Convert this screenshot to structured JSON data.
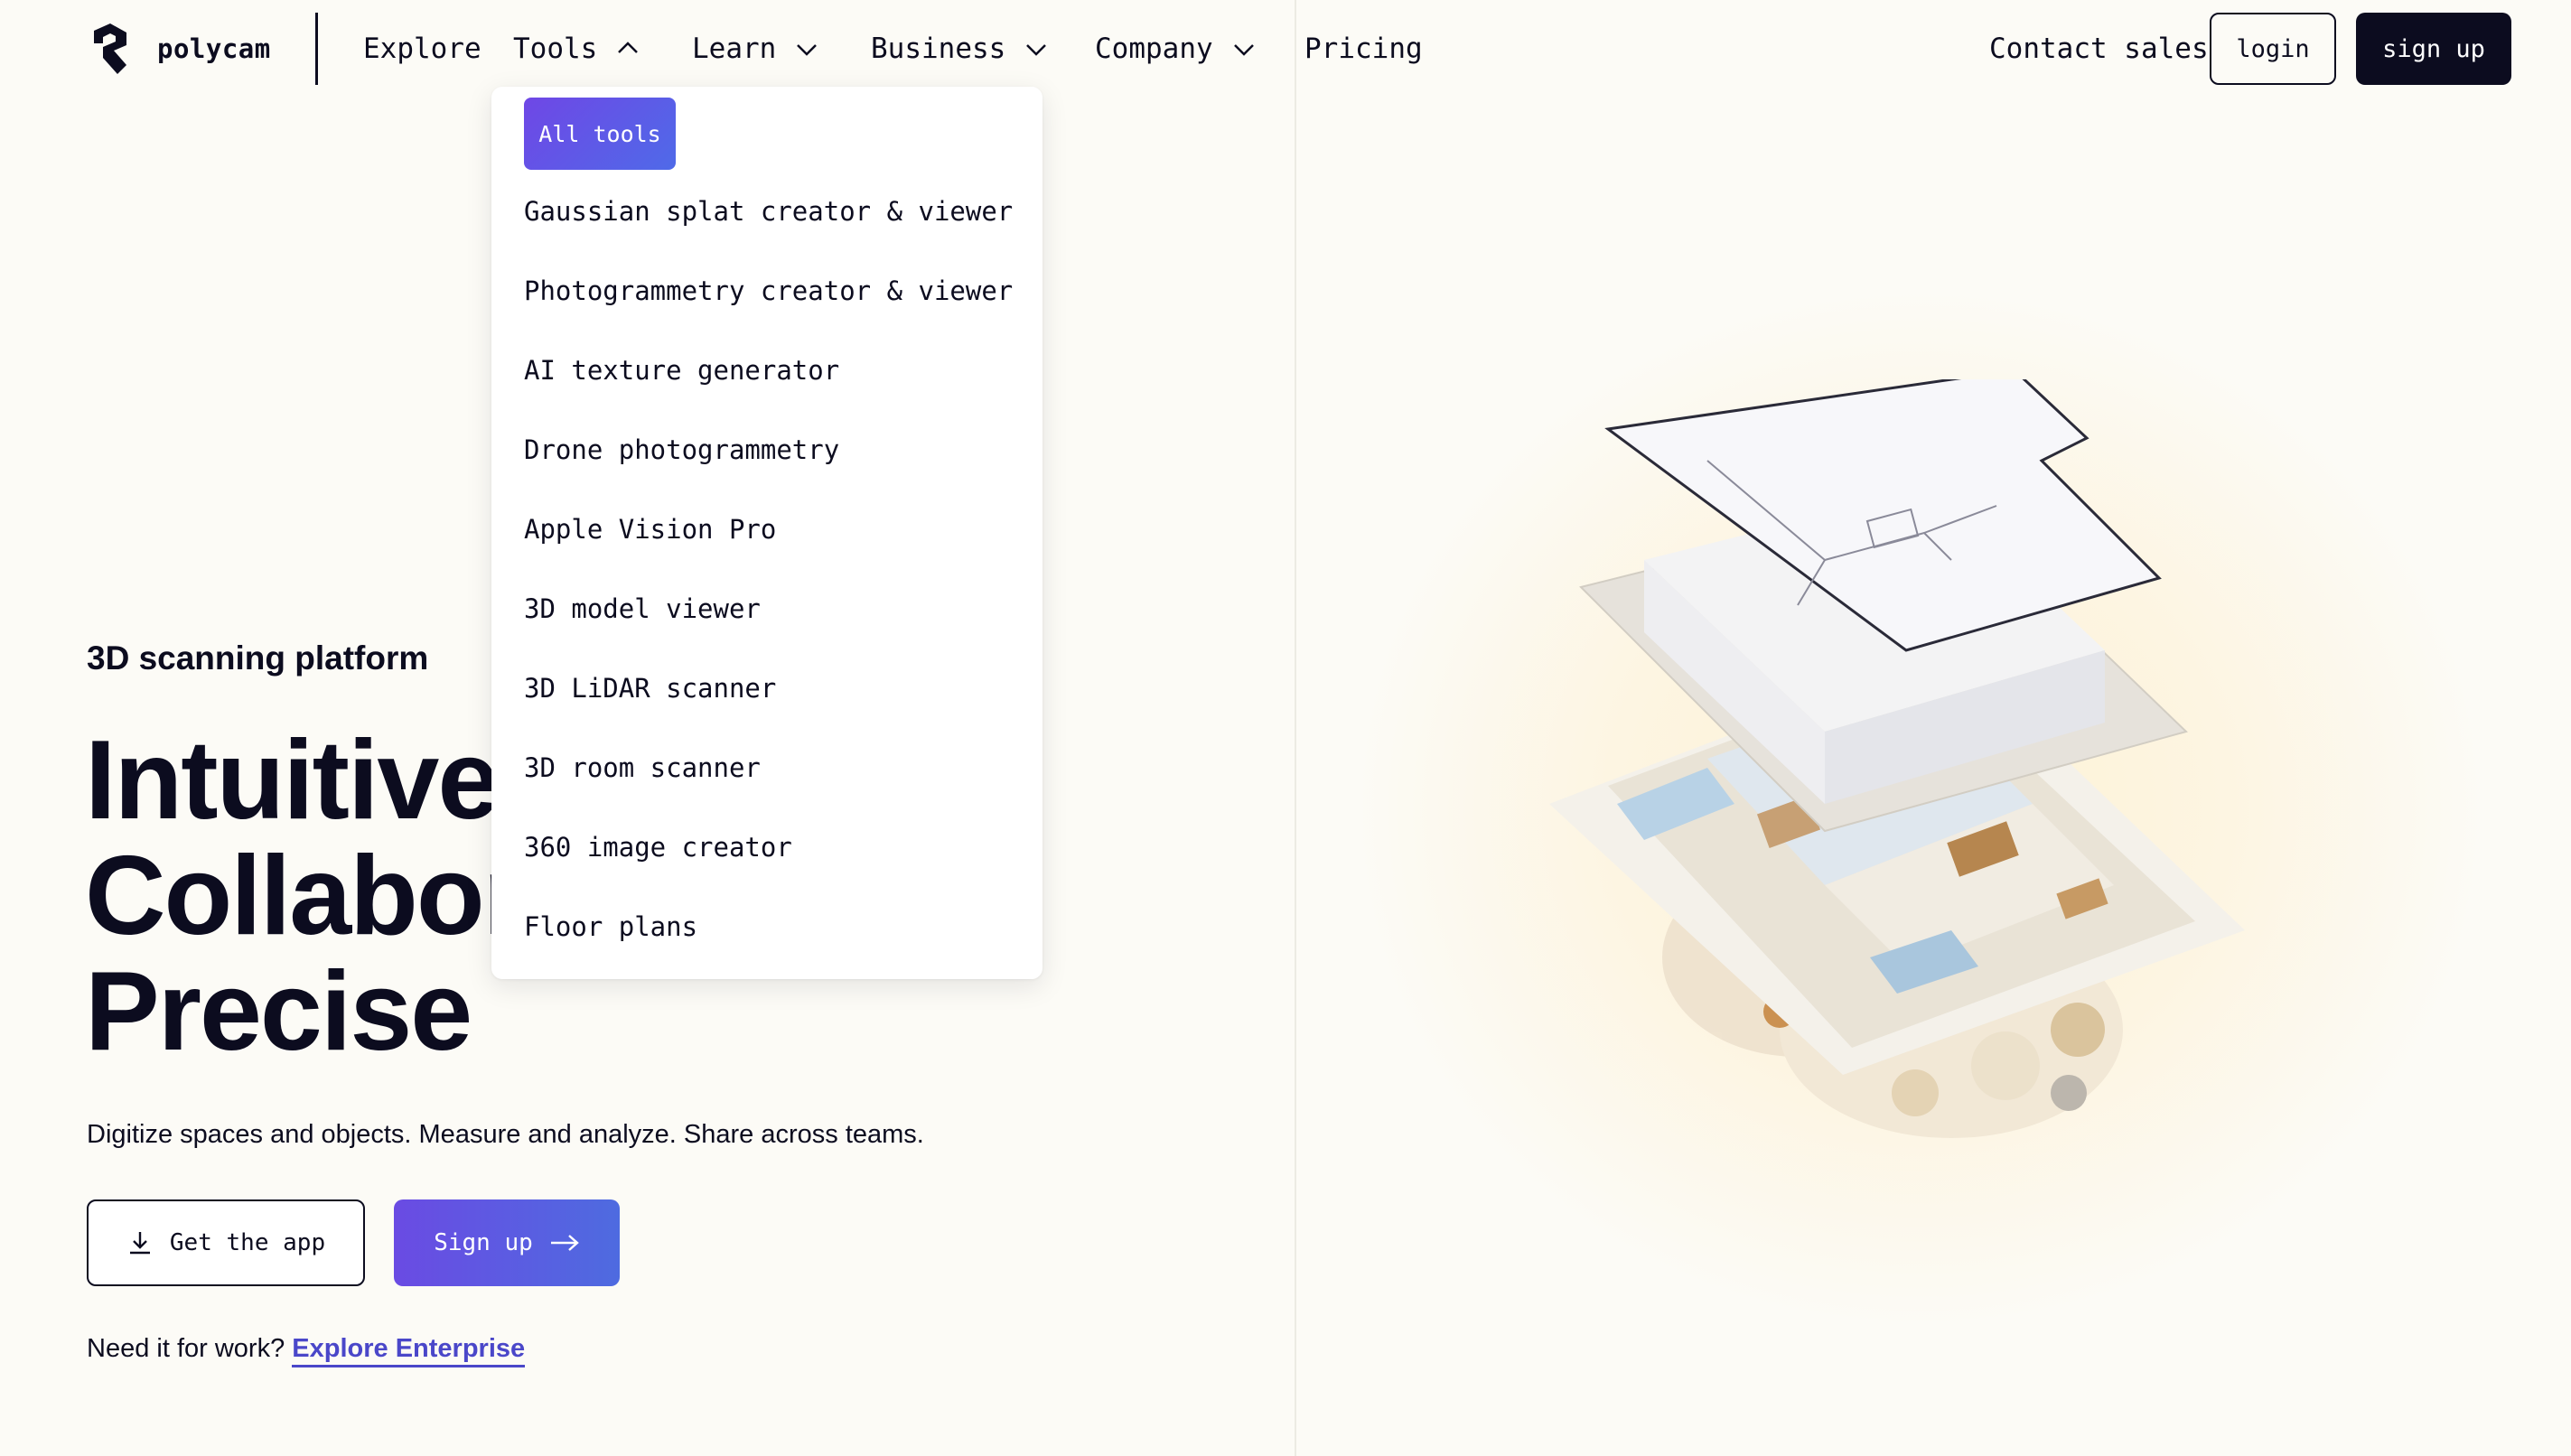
{
  "brand": {
    "name": "polycam"
  },
  "nav": {
    "items": [
      {
        "label": "Explore"
      },
      {
        "label": "Tools"
      },
      {
        "label": "Learn"
      },
      {
        "label": "Business"
      },
      {
        "label": "Company"
      },
      {
        "label": "Pricing"
      }
    ],
    "contact_sales": "Contact sales",
    "login": "login",
    "signup": "sign up"
  },
  "tools_menu": {
    "all_tools": "All tools",
    "items": [
      "Gaussian splat creator & viewer",
      "Photogrammetry creator & viewer",
      "AI texture generator",
      "Drone photogrammetry",
      "Apple Vision Pro",
      "3D model viewer",
      "3D LiDAR scanner",
      "3D room scanner",
      "360 image creator",
      "Floor plans"
    ]
  },
  "hero": {
    "eyebrow": "3D scanning platform",
    "headline_lines": [
      "Intuitive",
      "Collabor",
      "Precise"
    ],
    "subline": "Digitize spaces and objects. Measure and analyze. Share across teams.",
    "get_app": "Get the app",
    "signup": "Sign up",
    "work_prompt": "Need it for work?",
    "work_link": "Explore Enterprise"
  },
  "colors": {
    "ink": "#0c0c1f",
    "accent": "#5a58e3",
    "link": "#4a47c9",
    "background": "#fcfbf6"
  },
  "icons": {
    "logo": "polycam-logo-icon",
    "chevron_up": "chevron-up-icon",
    "chevron_down": "chevron-down-icon",
    "download": "download-icon",
    "arrow_right": "arrow-right-icon"
  }
}
